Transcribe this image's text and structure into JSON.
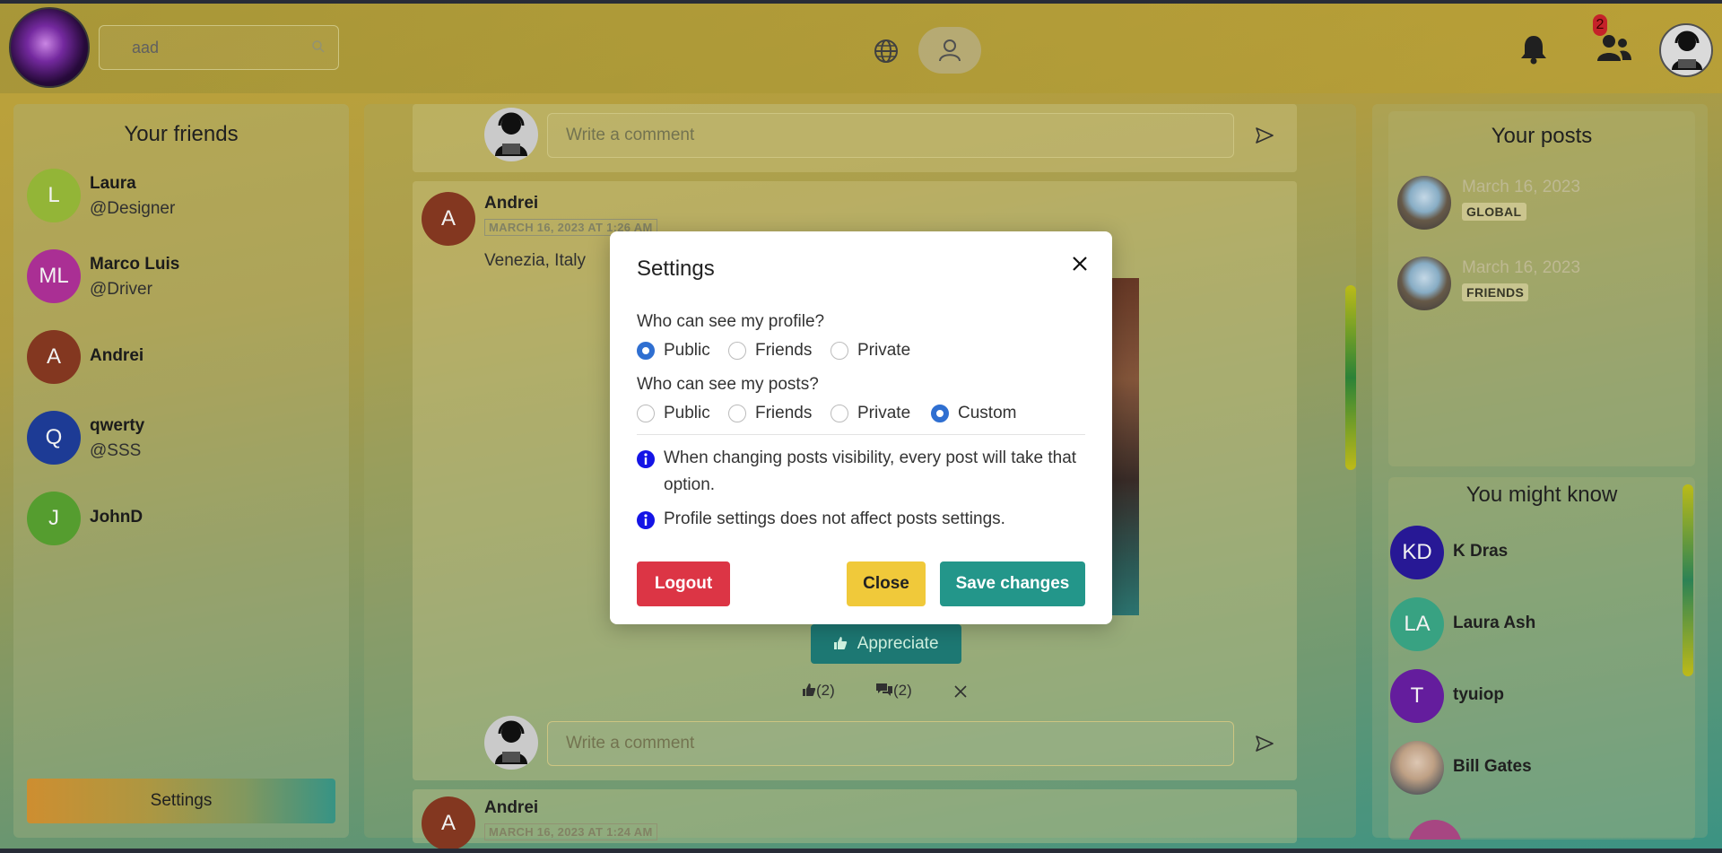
{
  "header": {
    "search_value": "aad",
    "notifications_badge": "2"
  },
  "left": {
    "title": "Your friends",
    "friends": [
      {
        "initials": "L",
        "name": "Laura",
        "handle": "@Designer",
        "color": "#9bbf3a"
      },
      {
        "initials": "ML",
        "name": "Marco Luis",
        "handle": "@Driver",
        "color": "#b4329c"
      },
      {
        "initials": "A",
        "name": "Andrei",
        "handle": "",
        "color": "#8b3a22"
      },
      {
        "initials": "Q",
        "name": "qwerty",
        "handle": "@SSS",
        "color": "#1f3f9e"
      },
      {
        "initials": "J",
        "name": "JohnD",
        "handle": "",
        "color": "#5aa632"
      }
    ],
    "settings_label": "Settings"
  },
  "feed": {
    "comment_placeholder": "Write a comment",
    "posts": [
      {
        "initials": "A",
        "author": "Andrei",
        "date": "MARCH 16, 2023 AT 1:26 AM",
        "location": "Venezia, Italy",
        "appreciate_label": "Appreciate",
        "likes": "(2)",
        "comments": "(2)"
      },
      {
        "initials": "A",
        "author": "Andrei",
        "date": "MARCH 16, 2023 AT 1:24 AM"
      }
    ]
  },
  "right": {
    "posts_title": "Your posts",
    "my_posts": [
      {
        "date": "March 16, 2023",
        "tag": "GLOBAL"
      },
      {
        "date": "March 16, 2023",
        "tag": "FRIENDS"
      }
    ],
    "know_title": "You might know",
    "people": [
      {
        "initials": "KD",
        "name": "K Dras",
        "color": "#2a1a9e"
      },
      {
        "initials": "LA",
        "name": "Laura Ash",
        "color": "#3bab8a"
      },
      {
        "initials": "T",
        "name": "tyuiop",
        "color": "#6a1fa6"
      },
      {
        "initials": "",
        "name": "Bill Gates",
        "color": "#cfcfcf"
      }
    ]
  },
  "modal": {
    "title": "Settings",
    "profile_question": "Who can see my profile?",
    "profile_options": [
      "Public",
      "Friends",
      "Private"
    ],
    "profile_selected": "Public",
    "posts_question": "Who can see my posts?",
    "posts_options": [
      "Public",
      "Friends",
      "Private",
      "Custom"
    ],
    "posts_selected": "Custom",
    "info_1": "When changing posts visibility, every post will take that option.",
    "info_2": "Profile settings does not affect posts settings.",
    "logout_label": "Logout",
    "close_label": "Close",
    "save_label": "Save changes"
  }
}
